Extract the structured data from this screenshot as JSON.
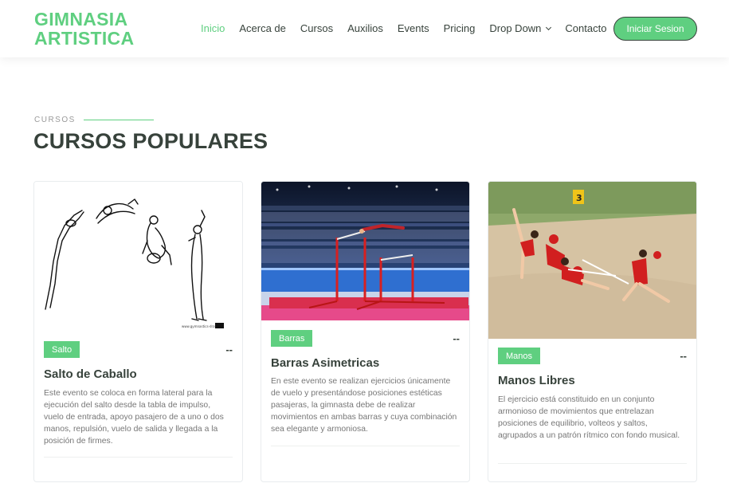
{
  "brand": {
    "line1": "GIMNASIA",
    "line2": "ARTISTICA"
  },
  "nav": {
    "items": [
      {
        "label": "Inicio"
      },
      {
        "label": "Acerca de"
      },
      {
        "label": "Cursos"
      },
      {
        "label": "Auxilios"
      },
      {
        "label": "Events"
      },
      {
        "label": "Pricing"
      },
      {
        "label": "Drop Down"
      },
      {
        "label": "Contacto"
      }
    ],
    "login_label": "Iniciar Sesion"
  },
  "section": {
    "label": "CURSOS",
    "title": "CURSOS POPULARES"
  },
  "courses": [
    {
      "badge": "Salto",
      "price": "--",
      "title": "Salto de Caballo",
      "description": "Este evento se coloca en forma lateral para la ejecución del salto desde la tabla de impulso, vuelo de entrada, apoyo pasajero de a uno o dos manos, repulsión, vuelo de salida y llegada a la posición de firmes.",
      "image": "vault-sequence-illustration"
    },
    {
      "badge": "Barras",
      "price": "--",
      "title": "Barras Asimetricas",
      "description": "En este evento se realizan ejercicios únicamente de vuelo y presentándose posiciones estéticas pasajeras, la gimnasta debe de realizar movimientos en ambas barras y cuya combinación sea elegante y armoniosa.",
      "image": "uneven-bars-photo"
    },
    {
      "badge": "Manos",
      "price": "--",
      "title": "Manos Libres",
      "description": "El ejercicio está constituido en un conjunto armonioso de movimientos que entrelazan posiciones de equilibrio, volteos y saltos, agrupados a un patrón rítmico con fondo musical.",
      "image": "rhythmic-gymnastics-photo"
    }
  ],
  "colors": {
    "accent": "#5fcf80",
    "dark": "#37423b",
    "muted": "#777777"
  }
}
